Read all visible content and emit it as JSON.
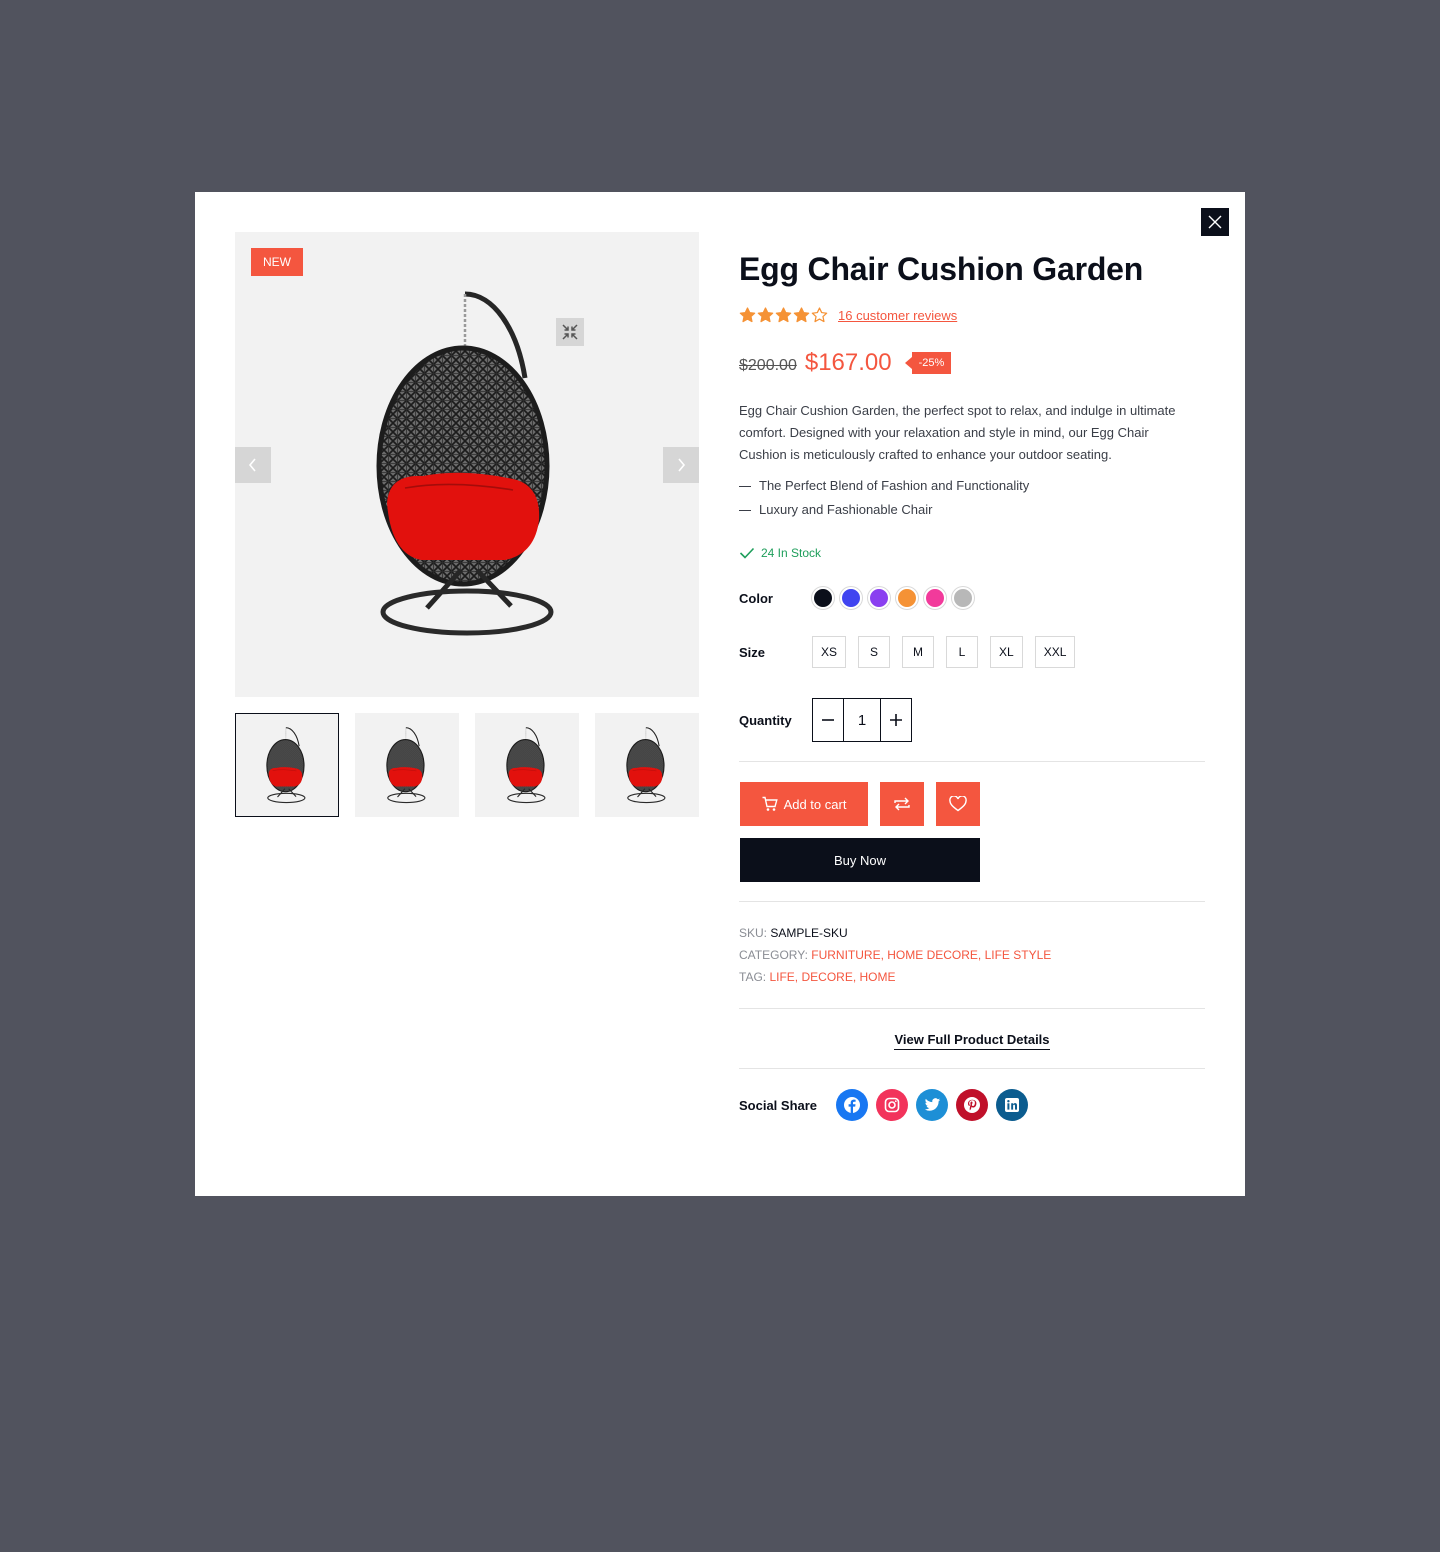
{
  "modal": {
    "close_label": "Close"
  },
  "gallery": {
    "badge": "NEW",
    "thumbnail_count": 4
  },
  "product": {
    "title": "Egg Chair Cushion Garden",
    "rating": 4,
    "rating_max": 5,
    "reviews_label": "16 customer reviews",
    "old_price": "$200.00",
    "price": "$167.00",
    "discount": "-25%",
    "description": "Egg Chair Cushion Garden, the perfect spot to relax, and indulge in ultimate comfort. Designed with your relaxation and style in mind, our Egg Chair Cushion is meticulously crafted to enhance your outdoor seating.",
    "features": [
      "The Perfect Blend of Fashion and Functionality",
      "Luxury and Fashionable Chair"
    ],
    "stock": "24 In Stock"
  },
  "options": {
    "color_label": "Color",
    "colors": [
      "#0b0f1a",
      "#4044f0",
      "#8a3ff0",
      "#f59235",
      "#f23a9b",
      "#b8b8b8"
    ],
    "size_label": "Size",
    "sizes": [
      "XS",
      "S",
      "M",
      "L",
      "XL",
      "XXL"
    ],
    "quantity_label": "Quantity",
    "quantity": "1"
  },
  "actions": {
    "add_to_cart": "Add to cart",
    "buy_now": "Buy Now"
  },
  "meta": {
    "sku_label": "SKU:",
    "sku": "SAMPLE-SKU",
    "category_label": "CATEGORY:",
    "categories": "FURNITURE, HOME DECORE, LIFE STYLE",
    "tag_label": "TAG:",
    "tags": "LIFE, DECORE, HOME"
  },
  "links": {
    "view_full": "View Full Product Details"
  },
  "social": {
    "label": "Social Share",
    "networks": [
      {
        "name": "facebook",
        "color": "#1877f2"
      },
      {
        "name": "instagram",
        "color": "#f2335b"
      },
      {
        "name": "twitter",
        "color": "#1d8fd6"
      },
      {
        "name": "pinterest",
        "color": "#c0102a"
      },
      {
        "name": "linkedin",
        "color": "#0b5c8f"
      }
    ]
  },
  "colors": {
    "accent": "#f4563f",
    "dark": "#0b0f1a",
    "stock": "#1e9e5b",
    "overlay": "#51535e"
  }
}
